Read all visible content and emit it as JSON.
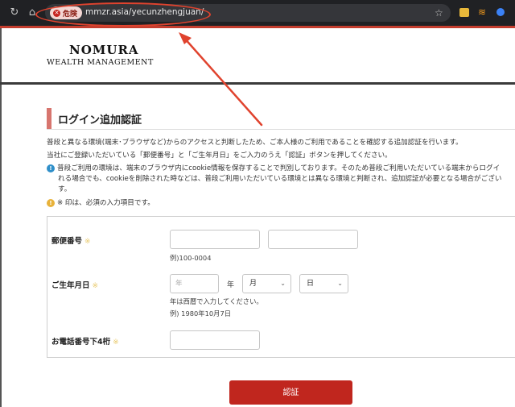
{
  "browser": {
    "danger_label": "危険",
    "url": "mmzr.asia/yecunzhengjuan/"
  },
  "logo": {
    "line1": "NOMURA",
    "line2": "WEALTH MANAGEMENT"
  },
  "page": {
    "title": "ログイン追加認証",
    "intro1": "普段と異なる環境(端末･ブラウザなど)からのアクセスと判断したため、ご本人様のご利用であることを確認する追加認証を行います。",
    "intro2": "当社にご登録いただいている「郵便番号」と「ご生年月日」をご入力のうえ「認証」ボタンを押してください。",
    "notice_line1": "普段ご利用の環境は、端末のブラウザ内にcookie情報を保存することで判別しております。そのため普段ご利用いただいている端末からログイ",
    "notice_line2": "れる場合でも、cookieを削除された時などは、普段ご利用いただいている環境とは異なる環境と判断され、追加認証が必要となる場合がござい",
    "notice_line3": "す。",
    "required_note": "※ 印は、必須の入力項目です。"
  },
  "form": {
    "postal_label": "郵便番号",
    "postal_hint": "例)100-0004",
    "birth_label": "ご生年月日",
    "year_placeholder": "年",
    "year_unit": "年",
    "month_value": "月",
    "day_value": "日",
    "birth_hint1": "年は西暦で入力してください。",
    "birth_hint2": "例) 1980年10月7日",
    "phone_label": "お電話番号下4桁",
    "required_mark": "※",
    "submit_label": "認証"
  },
  "colors": {
    "annotation": "#e0432e",
    "submit": "#c0261e",
    "title_accent": "#d7756e"
  }
}
